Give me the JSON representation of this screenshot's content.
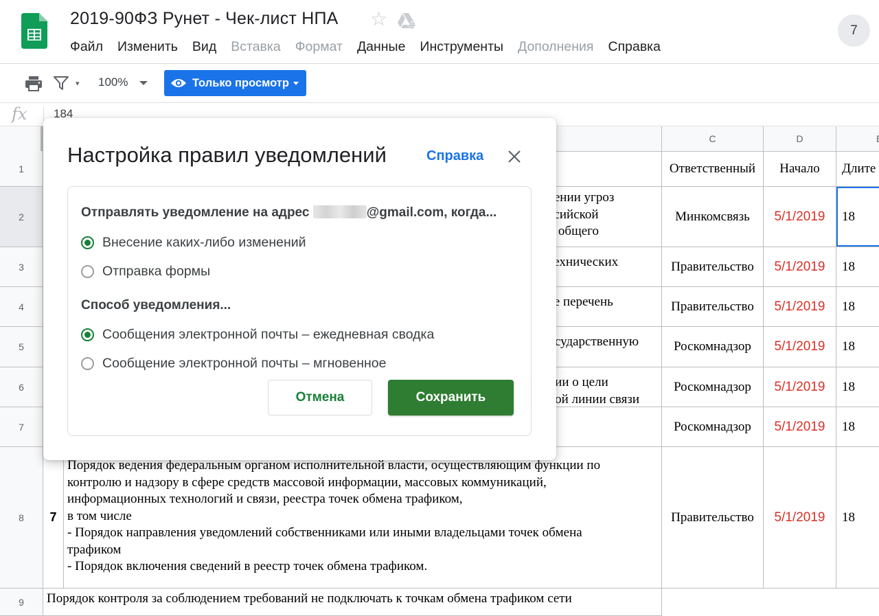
{
  "doc": {
    "title": "2019-90ФЗ Рунет - Чек-лист НПА"
  },
  "menu": {
    "items": [
      {
        "label": "Файл",
        "disabled": false
      },
      {
        "label": "Изменить",
        "disabled": false
      },
      {
        "label": "Вид",
        "disabled": false
      },
      {
        "label": "Вставка",
        "disabled": true
      },
      {
        "label": "Формат",
        "disabled": true
      },
      {
        "label": "Данные",
        "disabled": false
      },
      {
        "label": "Инструменты",
        "disabled": false
      },
      {
        "label": "Дополнения",
        "disabled": true
      },
      {
        "label": "Справка",
        "disabled": false
      }
    ]
  },
  "header": {
    "avatar_text": "7"
  },
  "toolbar": {
    "zoom": "100%",
    "view_mode": "Только просмотр"
  },
  "formula_bar": {
    "fx": "fx",
    "value": "184"
  },
  "grid": {
    "columns": [
      "C",
      "D",
      "E"
    ],
    "rows": [
      {
        "num": "1",
        "c": "Ответственный",
        "d": "Начало",
        "e": "Длите т"
      },
      {
        "num": "2",
        "c": "Минкомсвязь",
        "d": "5/1/2019",
        "e": "18",
        "b_lines": [
          "вении угроз",
          "ссийской",
          "и общего"
        ]
      },
      {
        "num": "3",
        "c": "Правительство",
        "d": "5/1/2019",
        "e": "18",
        "b_lines": [
          "технических"
        ]
      },
      {
        "num": "4",
        "c": "Правительство",
        "d": "5/1/2019",
        "e": "18",
        "b_lines": [
          "ке перечень"
        ]
      },
      {
        "num": "5",
        "c": "Роскомнадзор",
        "d": "5/1/2019",
        "e": "18",
        "b_lines": [
          "осударственную"
        ]
      },
      {
        "num": "6",
        "c": "Роскомнадзор",
        "d": "5/1/2019",
        "e": "18",
        "b_lines": [
          "ции о цели",
          "ной линии связи"
        ]
      },
      {
        "num": "7",
        "c": "Роскомнадзор",
        "d": "5/1/2019",
        "e": "18",
        "b_lines": []
      },
      {
        "num": "8",
        "a": "7",
        "c": "Правительство",
        "d": "5/1/2019",
        "e": "18",
        "b_lines": [
          "Порядок ведения федеральным органом исполнительной власти, осуществляющим функции по",
          "контролю и надзору в сфере средств массовой информации, массовых коммуникаций,",
          "информационных технологий и связи, реестра точек обмена трафиком,",
          "в том числе",
          "- Порядок направления уведомлений собственниками или иными владельцами точек обмена",
          "трафиком",
          "- Порядок включения сведений в реестр точек обмена трафиком."
        ]
      },
      {
        "num": "9",
        "b_lines": [
          "Порядок контроля за соблюдением требований не подключать к точкам обмена трафиком сети"
        ]
      }
    ]
  },
  "dialog": {
    "title": "Настройка правил уведомлений",
    "help": "Справка",
    "send_label_prefix": "Отправлять уведомление на адрес",
    "send_label_suffix": "@gmail.com, когда...",
    "trigger_options": [
      {
        "label": "Внесение каких-либо изменений",
        "selected": true
      },
      {
        "label": "Отправка формы",
        "selected": false
      }
    ],
    "method_label": "Способ уведомления...",
    "method_options": [
      {
        "label": "Сообщения электронной почты – ежедневная сводка",
        "selected": true
      },
      {
        "label": "Сообщение электронной почты – мгновенное",
        "selected": false
      }
    ],
    "cancel": "Отмена",
    "save": "Сохранить"
  },
  "colors": {
    "accent": "#1a73e8",
    "save": "#2e7d32",
    "date": "#d93025",
    "radio_on": "#188038"
  }
}
